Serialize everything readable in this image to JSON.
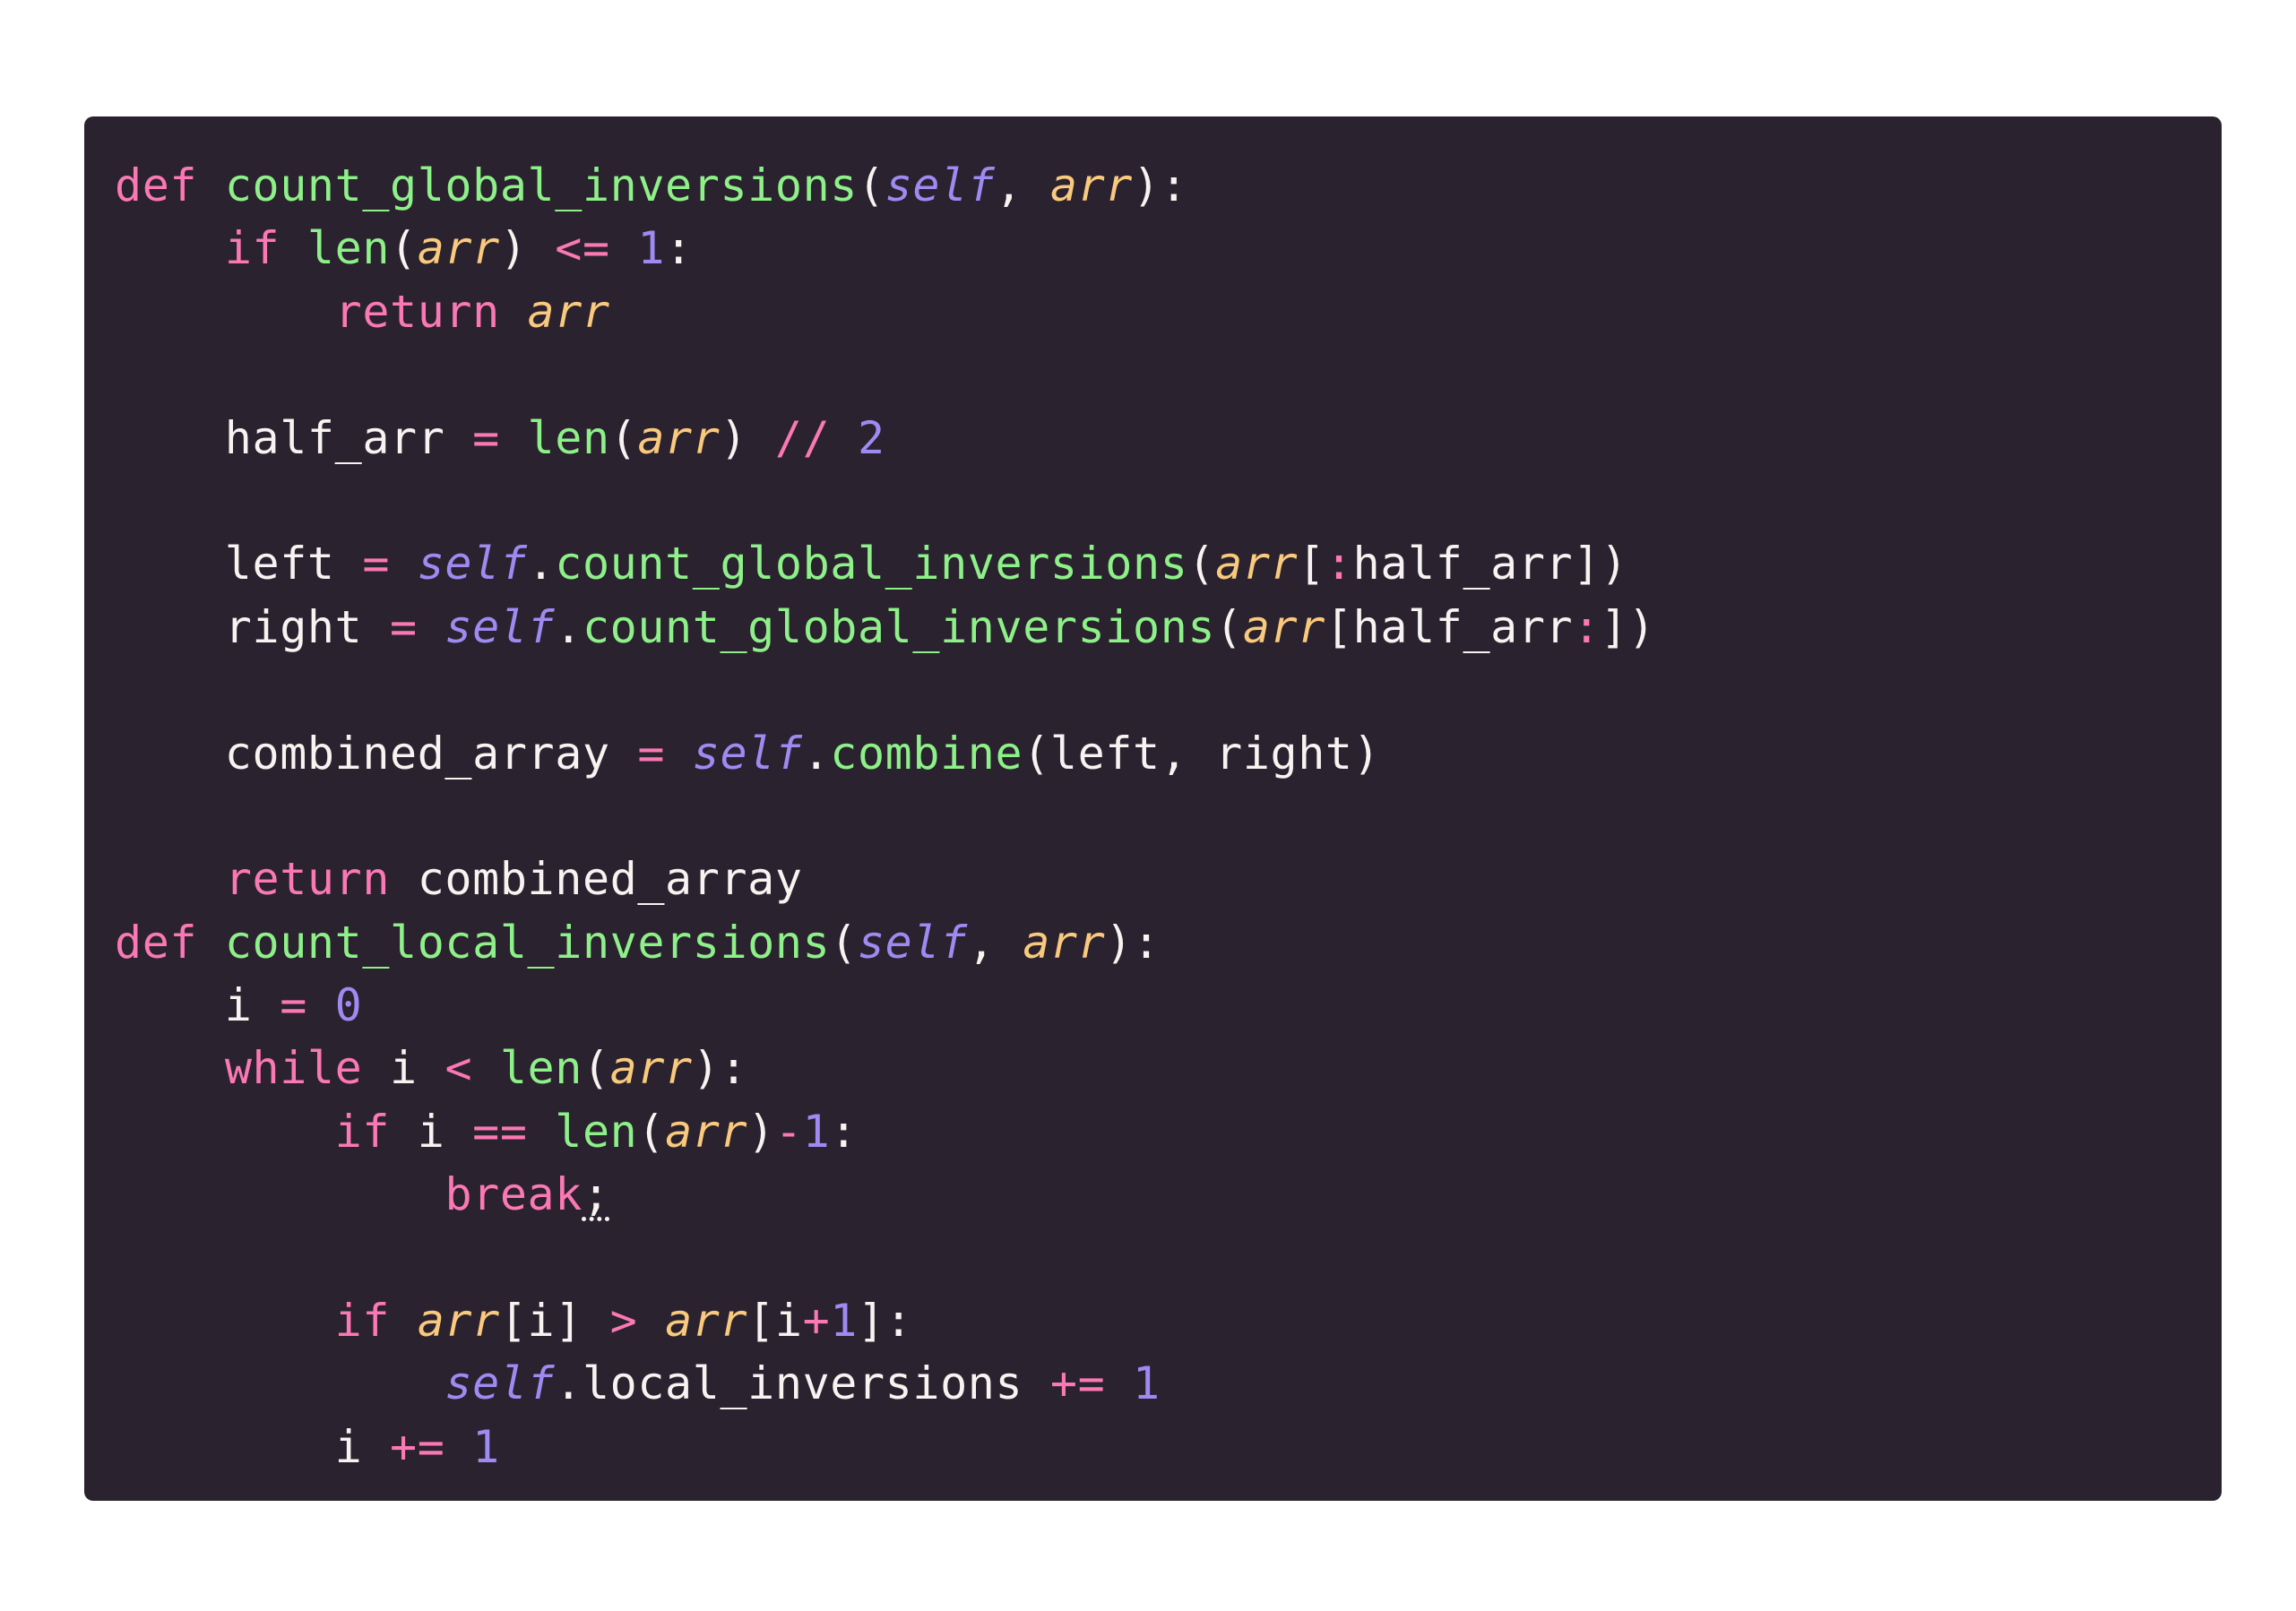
{
  "editor": {
    "language": "python",
    "colors": {
      "background": "#2a222e",
      "keyword": "#fa78b4",
      "function": "#8ef089",
      "self": "#9d8bf1",
      "parameter": "#f9c97e",
      "number": "#9d8bf1",
      "text": "#f6f3f1"
    },
    "lines": [
      [
        [
          "kw",
          "def"
        ],
        [
          "id",
          " "
        ],
        [
          "fn",
          "count_global_inversions"
        ],
        [
          "punct",
          "("
        ],
        [
          "self",
          "self"
        ],
        [
          "punct",
          ", "
        ],
        [
          "param",
          "arr"
        ],
        [
          "punct",
          "):"
        ]
      ],
      [
        [
          "id",
          "    "
        ],
        [
          "kw",
          "if"
        ],
        [
          "id",
          " "
        ],
        [
          "fn",
          "len"
        ],
        [
          "punct",
          "("
        ],
        [
          "param",
          "arr"
        ],
        [
          "punct",
          ")"
        ],
        [
          "id",
          " "
        ],
        [
          "op",
          "<="
        ],
        [
          "id",
          " "
        ],
        [
          "num",
          "1"
        ],
        [
          "punct",
          ":"
        ]
      ],
      [
        [
          "id",
          "        "
        ],
        [
          "kw",
          "return"
        ],
        [
          "id",
          " "
        ],
        [
          "param",
          "arr"
        ]
      ],
      [],
      [
        [
          "id",
          "    half_arr "
        ],
        [
          "op",
          "="
        ],
        [
          "id",
          " "
        ],
        [
          "fn",
          "len"
        ],
        [
          "punct",
          "("
        ],
        [
          "param",
          "arr"
        ],
        [
          "punct",
          ")"
        ],
        [
          "id",
          " "
        ],
        [
          "op",
          "//"
        ],
        [
          "id",
          " "
        ],
        [
          "num",
          "2"
        ]
      ],
      [],
      [
        [
          "id",
          "    left "
        ],
        [
          "op",
          "="
        ],
        [
          "id",
          " "
        ],
        [
          "self",
          "self"
        ],
        [
          "punct",
          "."
        ],
        [
          "fn",
          "count_global_inversions"
        ],
        [
          "punct",
          "("
        ],
        [
          "param",
          "arr"
        ],
        [
          "punct",
          "["
        ],
        [
          "op",
          ":"
        ],
        [
          "id",
          "half_arr"
        ],
        [
          "punct",
          "])"
        ]
      ],
      [
        [
          "id",
          "    right "
        ],
        [
          "op",
          "="
        ],
        [
          "id",
          " "
        ],
        [
          "self",
          "self"
        ],
        [
          "punct",
          "."
        ],
        [
          "fn",
          "count_global_inversions"
        ],
        [
          "punct",
          "("
        ],
        [
          "param",
          "arr"
        ],
        [
          "punct",
          "["
        ],
        [
          "id",
          "half_arr"
        ],
        [
          "op",
          ":"
        ],
        [
          "punct",
          "])"
        ]
      ],
      [],
      [
        [
          "id",
          "    combined_array "
        ],
        [
          "op",
          "="
        ],
        [
          "id",
          " "
        ],
        [
          "self",
          "self"
        ],
        [
          "punct",
          "."
        ],
        [
          "fn",
          "combine"
        ],
        [
          "punct",
          "("
        ],
        [
          "id",
          "left, right"
        ],
        [
          "punct",
          ")"
        ]
      ],
      [],
      [
        [
          "id",
          "    "
        ],
        [
          "kw",
          "return"
        ],
        [
          "id",
          " combined_array"
        ]
      ],
      [
        [
          "kw",
          "def"
        ],
        [
          "id",
          " "
        ],
        [
          "fn",
          "count_local_inversions"
        ],
        [
          "punct",
          "("
        ],
        [
          "self",
          "self"
        ],
        [
          "punct",
          ", "
        ],
        [
          "param",
          "arr"
        ],
        [
          "punct",
          "):"
        ]
      ],
      [
        [
          "id",
          "    i "
        ],
        [
          "op",
          "="
        ],
        [
          "id",
          " "
        ],
        [
          "num",
          "0"
        ]
      ],
      [
        [
          "id",
          "    "
        ],
        [
          "kw",
          "while"
        ],
        [
          "id",
          " i "
        ],
        [
          "op",
          "<"
        ],
        [
          "id",
          " "
        ],
        [
          "fn",
          "len"
        ],
        [
          "punct",
          "("
        ],
        [
          "param",
          "arr"
        ],
        [
          "punct",
          "):"
        ]
      ],
      [
        [
          "id",
          "        "
        ],
        [
          "kw",
          "if"
        ],
        [
          "id",
          " i "
        ],
        [
          "op",
          "=="
        ],
        [
          "id",
          " "
        ],
        [
          "fn",
          "len"
        ],
        [
          "punct",
          "("
        ],
        [
          "param",
          "arr"
        ],
        [
          "punct",
          ")"
        ],
        [
          "op",
          "-"
        ],
        [
          "num",
          "1"
        ],
        [
          "punct",
          ":"
        ]
      ],
      [
        [
          "id",
          "            "
        ],
        [
          "kw",
          "break"
        ],
        [
          "err",
          ";"
        ]
      ],
      [],
      [
        [
          "id",
          "        "
        ],
        [
          "kw",
          "if"
        ],
        [
          "id",
          " "
        ],
        [
          "param",
          "arr"
        ],
        [
          "punct",
          "["
        ],
        [
          "id",
          "i"
        ],
        [
          "punct",
          "]"
        ],
        [
          "id",
          " "
        ],
        [
          "op",
          ">"
        ],
        [
          "id",
          " "
        ],
        [
          "param",
          "arr"
        ],
        [
          "punct",
          "["
        ],
        [
          "id",
          "i"
        ],
        [
          "op",
          "+"
        ],
        [
          "num",
          "1"
        ],
        [
          "punct",
          "]:"
        ]
      ],
      [
        [
          "id",
          "            "
        ],
        [
          "self",
          "self"
        ],
        [
          "punct",
          "."
        ],
        [
          "id",
          "local_inversions "
        ],
        [
          "op",
          "+="
        ],
        [
          "id",
          " "
        ],
        [
          "num",
          "1"
        ]
      ],
      [
        [
          "id",
          "        i "
        ],
        [
          "op",
          "+="
        ],
        [
          "id",
          " "
        ],
        [
          "num",
          "1"
        ]
      ]
    ]
  }
}
